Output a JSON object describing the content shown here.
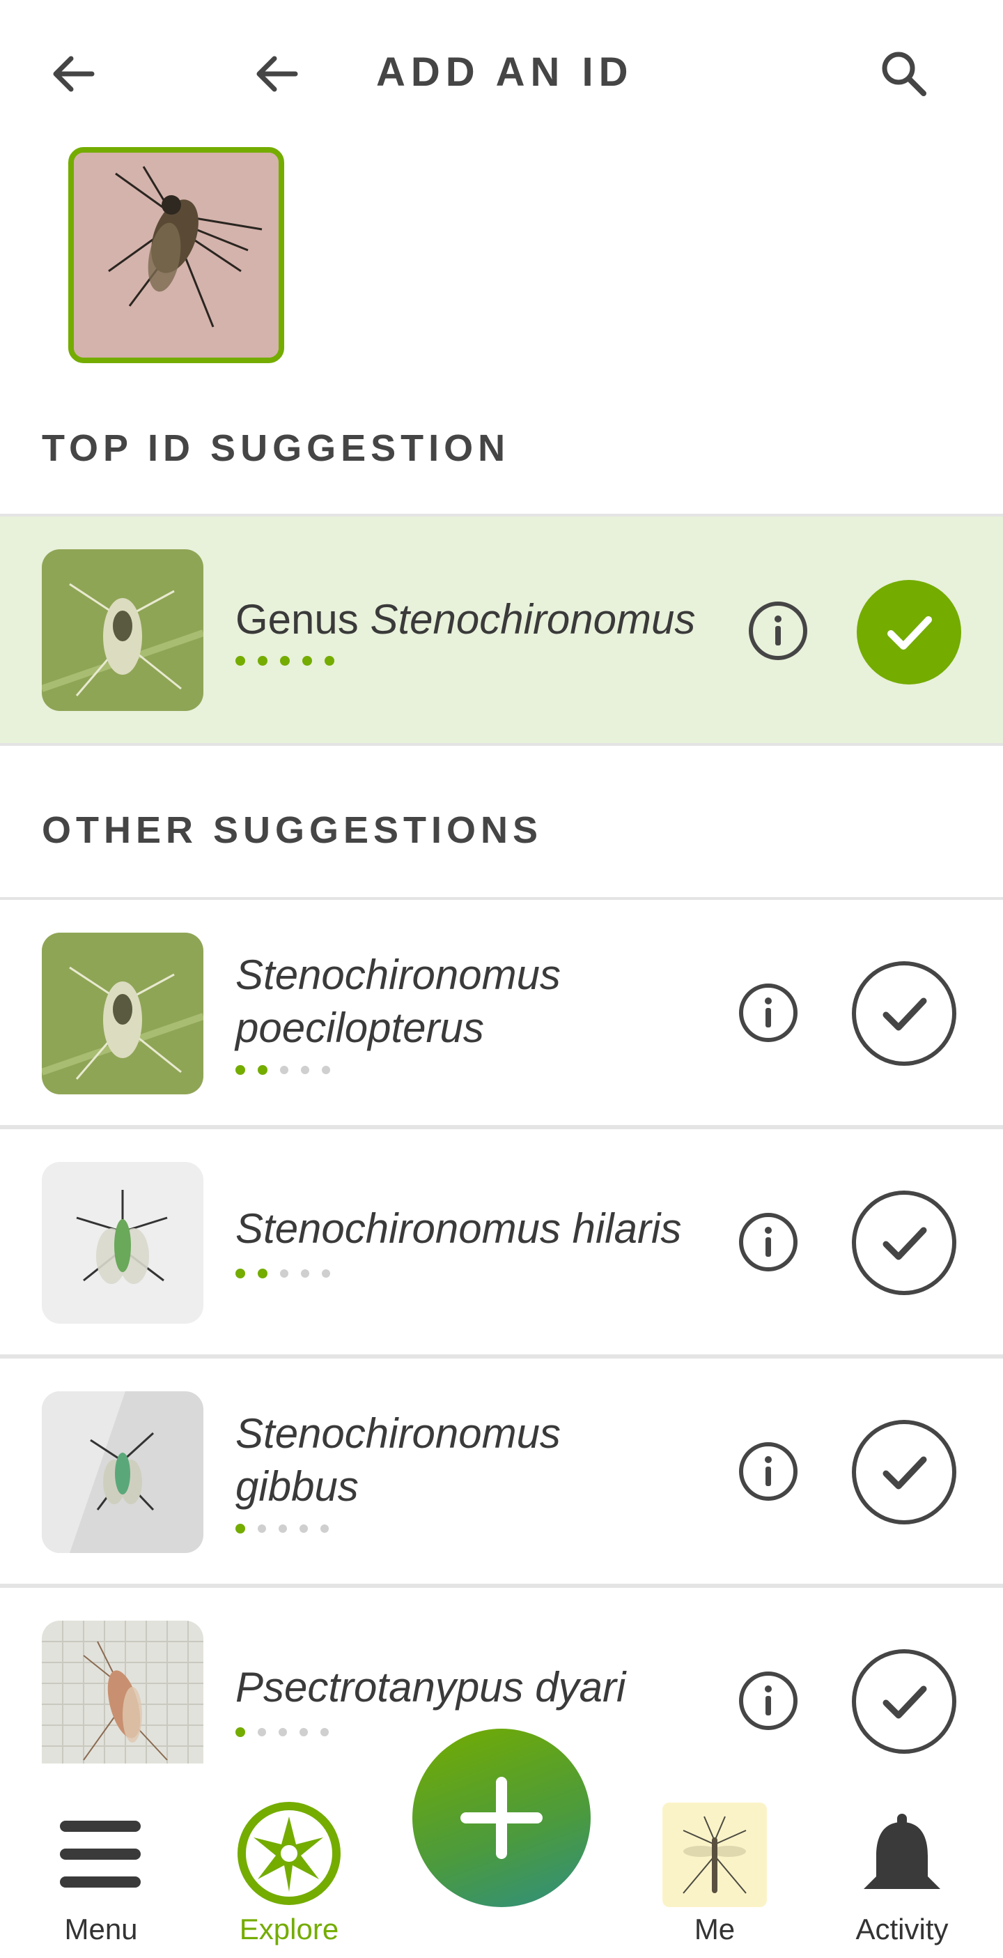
{
  "header": {
    "title": "ADD AN ID",
    "icons": [
      "back-arrow-icon",
      "back-arrow-icon",
      "search-icon"
    ]
  },
  "top_section": {
    "title": "TOP ID SUGGESTION"
  },
  "top_suggestion": {
    "rank": "Genus",
    "name": "Stenochironomus",
    "confidence_dots": 5,
    "confidence_total": 5
  },
  "other_section": {
    "title": "OTHER SUGGESTIONS"
  },
  "other_suggestions": [
    {
      "line1": "Stenochironomus",
      "line2": "poecilopterus",
      "confidence_dots": 2,
      "confidence_total": 5
    },
    {
      "line1": "Stenochironomus hilaris",
      "line2": "",
      "confidence_dots": 2,
      "confidence_total": 5
    },
    {
      "line1": "Stenochironomus",
      "line2": "gibbus",
      "confidence_dots": 1,
      "confidence_total": 5
    },
    {
      "line1": "Psectrotanypus dyari",
      "line2": "",
      "confidence_dots": 1,
      "confidence_total": 5
    }
  ],
  "nav": {
    "menu": "Menu",
    "explore": "Explore",
    "me": "Me",
    "activity": "Activity"
  },
  "colors": {
    "accent": "#74ac00",
    "top_bg": "#e8f1da",
    "text": "#454545"
  }
}
